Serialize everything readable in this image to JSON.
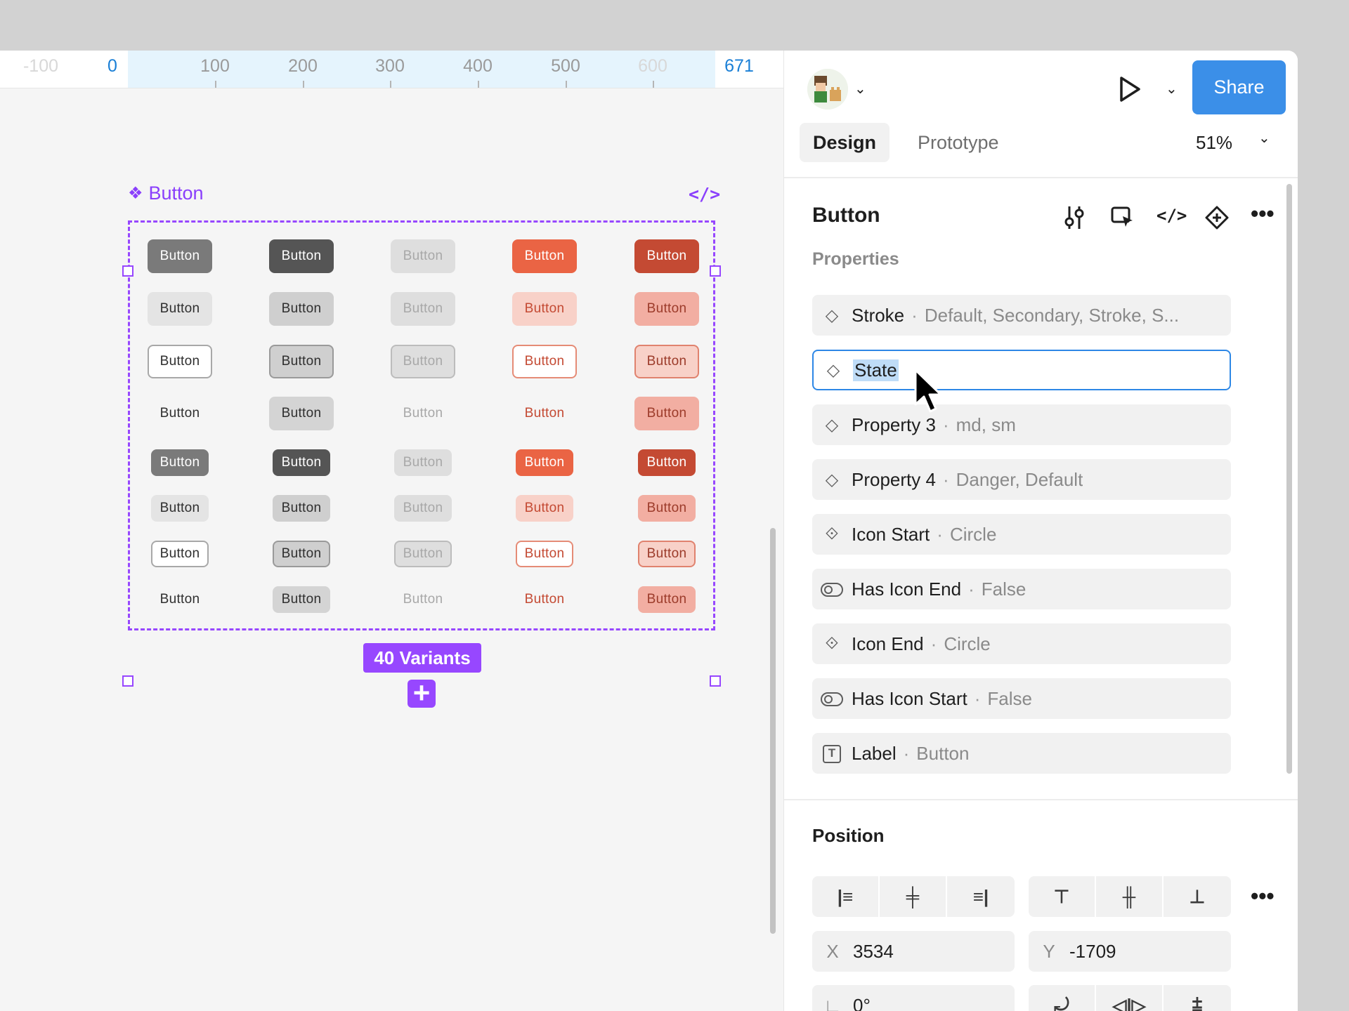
{
  "ruler": {
    "ticks": [
      "-100",
      "0",
      "100",
      "200",
      "300",
      "400",
      "500",
      "600",
      "671"
    ]
  },
  "canvas": {
    "component_title": "Button",
    "variants_badge": "40 Variants",
    "grid": {
      "label": "Button",
      "rows": [
        [
          "#7a7a7a|#ffffff|",
          "#555555|#ffffff|",
          "#dedede|#a8a8a8|",
          "#ea6444|#ffffff|",
          "#c44a33|#ffffff|"
        ],
        [
          "#e4e4e4|#2f2f2f|",
          "#cfcfcf|#2f2f2f|",
          "#dedede|#a8a8a8|",
          "#f8d1c8|#c44a33|",
          "#f2aea2|#9c3b2a|"
        ],
        [
          "#ffffff|#2f2f2f|#a8a8a8",
          "#cfcfcf|#2f2f2f|#9a9a9a",
          "#dedede|#a8a8a8|#bcbcbc",
          "#ffffff|#c44a33|#e58b76",
          "#f8d1c8|#9c3b2a|#e0826e"
        ],
        [
          "transparent|#2f2f2f|",
          "#d4d4d4|#2f2f2f|",
          "transparent|#a8a8a8|",
          "transparent|#c44a33|",
          "#f2aea2|#9c3b2a|"
        ],
        [
          "#7a7a7a|#ffffff|",
          "#555555|#ffffff|",
          "#dedede|#a8a8a8|",
          "#ea6444|#ffffff|",
          "#c44a33|#ffffff|"
        ],
        [
          "#e4e4e4|#2f2f2f|",
          "#cfcfcf|#2f2f2f|",
          "#dedede|#a8a8a8|",
          "#f8d1c8|#c44a33|",
          "#f2aea2|#9c3b2a|"
        ],
        [
          "#ffffff|#2f2f2f|#a8a8a8",
          "#cfcfcf|#2f2f2f|#9a9a9a",
          "#dedede|#a8a8a8|#bcbcbc",
          "#ffffff|#c44a33|#e58b76",
          "#f8d1c8|#9c3b2a|#e0826e"
        ],
        [
          "transparent|#2f2f2f|",
          "#d4d4d4|#2f2f2f|",
          "transparent|#a8a8a8|",
          "transparent|#c44a33|",
          "#f2aea2|#9c3b2a|"
        ]
      ]
    }
  },
  "toolbar": {
    "share_label": "Share"
  },
  "tabs": {
    "design": "Design",
    "prototype": "Prototype",
    "zoom": "51%"
  },
  "panel": {
    "component_name": "Button",
    "properties_heading": "Properties",
    "properties": [
      {
        "icon": "variant-diamond-icon",
        "name": "Stroke",
        "values": "Default, Secondary, Stroke, S..."
      },
      {
        "icon": "variant-diamond-icon",
        "name": "State",
        "values": "",
        "editing": true
      },
      {
        "icon": "variant-diamond-icon",
        "name": "Property 3",
        "values": "md, sm"
      },
      {
        "icon": "variant-diamond-icon",
        "name": "Property 4",
        "values": "Danger, Default"
      },
      {
        "icon": "instance-swap-icon",
        "name": "Icon Start",
        "values": "Circle"
      },
      {
        "icon": "boolean-toggle-icon",
        "name": "Has Icon End",
        "values": "False"
      },
      {
        "icon": "instance-swap-icon",
        "name": "Icon End",
        "values": "Circle"
      },
      {
        "icon": "boolean-toggle-icon",
        "name": "Has Icon Start",
        "values": "False"
      },
      {
        "icon": "text-property-icon",
        "name": "Label",
        "values": "Button"
      }
    ],
    "position_heading": "Position",
    "x_label": "X",
    "x_value": "3534",
    "y_label": "Y",
    "y_value": "-1709",
    "rotation_value": "0°"
  },
  "colors": {
    "accent_purple": "#9747ff",
    "share_blue": "#3b8fe8",
    "selection_blue": "#2d87e6"
  }
}
